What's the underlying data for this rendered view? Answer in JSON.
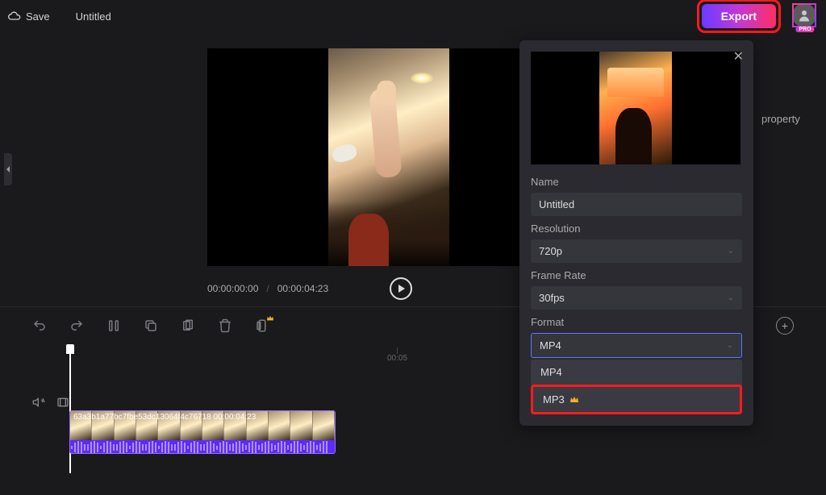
{
  "topbar": {
    "save_label": "Save",
    "title": "Untitled",
    "export_label": "Export",
    "pro_label": "PRO"
  },
  "preview": {
    "current_time": "00:00:00:00",
    "total_time": "00:00:04:23"
  },
  "sidebar_right": {
    "property_text": "property"
  },
  "timeline": {
    "tick_label": "00:05",
    "clip_label": "63a3b1a77bc7fbe53dc13064f4c76718 00:00:04:23"
  },
  "export_panel": {
    "name_label": "Name",
    "name_value": "Untitled",
    "resolution_label": "Resolution",
    "resolution_value": "720p",
    "framerate_label": "Frame Rate",
    "framerate_value": "30fps",
    "format_label": "Format",
    "format_value": "MP4",
    "format_options": {
      "mp4": "MP4",
      "mp3": "MP3"
    }
  }
}
